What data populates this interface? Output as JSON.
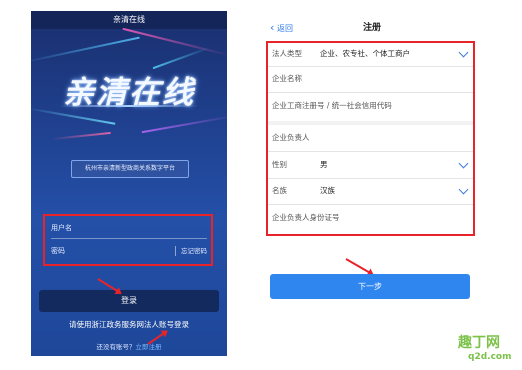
{
  "login": {
    "app_title": "亲清在线",
    "logo_text": "亲清在线",
    "platform_name": "杭州市亲清新型政商关系数字平台",
    "username_placeholder": "用户名",
    "password_placeholder": "密码",
    "forgot_password": "忘记密码",
    "login_button": "登录",
    "gov_login_link": "请使用浙江政务服务网法人账号登录",
    "no_account_text": "还没有账号？",
    "register_link": "立即注册"
  },
  "register": {
    "back_label": "返回",
    "title": "注册",
    "fields": {
      "legal_type_label": "法人类型",
      "legal_type_value": "企业、农专社、个体工商户",
      "company_name_label": "企业名称",
      "reg_number_label": "企业工商注册号 / 统一社会信用代码",
      "principal_label": "企业负责人",
      "gender_label": "性别",
      "gender_value": "男",
      "ethnicity_label": "名族",
      "ethnicity_value": "汉族",
      "id_number_label": "企业负责人身份证号"
    },
    "next_button": "下一步"
  },
  "watermark": {
    "logo": "趣丁网",
    "domain": "q2d.com"
  },
  "colors": {
    "highlight_red": "#e8242a",
    "login_blue": "#1f3f8c",
    "primary_button": "#2f86ef",
    "link_blue": "#2f7ae6",
    "watermark_green": "#7cc24a"
  }
}
